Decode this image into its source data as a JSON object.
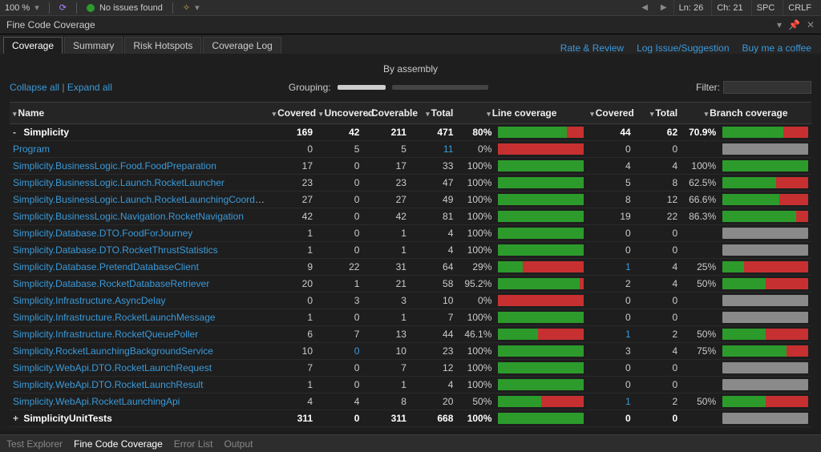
{
  "statusbar": {
    "zoom": "100 %",
    "issues": "No issues found",
    "ln": "Ln: 26",
    "ch": "Ch: 21",
    "spc": "SPC",
    "crlf": "CRLF"
  },
  "panel": {
    "title": "Fine Code Coverage"
  },
  "tabs": {
    "coverage": "Coverage",
    "summary": "Summary",
    "risk": "Risk Hotspots",
    "log": "Coverage Log"
  },
  "links": {
    "rate": "Rate & Review",
    "issue": "Log Issue/Suggestion",
    "coffee": "Buy me a coffee",
    "collapse": "Collapse all",
    "expand": "Expand all"
  },
  "labels": {
    "by_assembly": "By assembly",
    "grouping": "Grouping:",
    "filter": "Filter:"
  },
  "headers": {
    "name": "Name",
    "covered": "Covered",
    "uncovered": "Uncovered",
    "coverable": "Coverable",
    "total": "Total",
    "line_cov": "Line coverage",
    "covered2": "Covered",
    "total2": "Total",
    "branch_cov": "Branch coverage"
  },
  "rows": [
    {
      "type": "group",
      "expand": "-",
      "name": "Simplicity",
      "covered": "169",
      "uncovered": "42",
      "coverable": "211",
      "total": "471",
      "lpct": "80%",
      "lbar": 80,
      "bcov": "44",
      "btot": "62",
      "bpct": "70.9%",
      "bbar": 70.9
    },
    {
      "type": "item",
      "name": "Program",
      "covered": "0",
      "uncovered": "5",
      "coverable": "5",
      "total": "11",
      "total_low": true,
      "lpct": "0%",
      "lbar": 0,
      "bcov": "0",
      "btot": "0",
      "bpct": "",
      "bbar": null
    },
    {
      "type": "item",
      "name": "Simplicity.BusinessLogic.Food.FoodPreparation",
      "covered": "17",
      "uncovered": "0",
      "coverable": "17",
      "total": "33",
      "lpct": "100%",
      "lbar": 100,
      "bcov": "4",
      "btot": "4",
      "bpct": "100%",
      "bbar": 100
    },
    {
      "type": "item",
      "name": "Simplicity.BusinessLogic.Launch.RocketLauncher",
      "covered": "23",
      "uncovered": "0",
      "coverable": "23",
      "total": "47",
      "lpct": "100%",
      "lbar": 100,
      "bcov": "5",
      "btot": "8",
      "bpct": "62.5%",
      "bbar": 62.5
    },
    {
      "type": "item",
      "name": "Simplicity.BusinessLogic.Launch.RocketLaunchingCoordinator",
      "covered": "27",
      "uncovered": "0",
      "coverable": "27",
      "total": "49",
      "lpct": "100%",
      "lbar": 100,
      "bcov": "8",
      "btot": "12",
      "bpct": "66.6%",
      "bbar": 66.6
    },
    {
      "type": "item",
      "name": "Simplicity.BusinessLogic.Navigation.RocketNavigation",
      "covered": "42",
      "uncovered": "0",
      "coverable": "42",
      "total": "81",
      "lpct": "100%",
      "lbar": 100,
      "bcov": "19",
      "btot": "22",
      "bpct": "86.3%",
      "bbar": 86.3
    },
    {
      "type": "item",
      "name": "Simplicity.Database.DTO.FoodForJourney",
      "covered": "1",
      "uncovered": "0",
      "coverable": "1",
      "total": "4",
      "lpct": "100%",
      "lbar": 100,
      "bcov": "0",
      "btot": "0",
      "bpct": "",
      "bbar": null
    },
    {
      "type": "item",
      "name": "Simplicity.Database.DTO.RocketThrustStatistics",
      "covered": "1",
      "uncovered": "0",
      "coverable": "1",
      "total": "4",
      "lpct": "100%",
      "lbar": 100,
      "bcov": "0",
      "btot": "0",
      "bpct": "",
      "bbar": null
    },
    {
      "type": "item",
      "name": "Simplicity.Database.PretendDatabaseClient",
      "covered": "9",
      "uncovered": "22",
      "coverable": "31",
      "total": "64",
      "lpct": "29%",
      "lbar": 29,
      "bcov": "1",
      "bcov_low": true,
      "btot": "4",
      "bpct": "25%",
      "bbar": 25
    },
    {
      "type": "item",
      "name": "Simplicity.Database.RocketDatabaseRetriever",
      "covered": "20",
      "uncovered": "1",
      "coverable": "21",
      "total": "58",
      "lpct": "95.2%",
      "lbar": 95.2,
      "bcov": "2",
      "btot": "4",
      "bpct": "50%",
      "bbar": 50
    },
    {
      "type": "item",
      "name": "Simplicity.Infrastructure.AsyncDelay",
      "covered": "0",
      "uncovered": "3",
      "coverable": "3",
      "total": "10",
      "lpct": "0%",
      "lbar": 0,
      "bcov": "0",
      "btot": "0",
      "bpct": "",
      "bbar": null
    },
    {
      "type": "item",
      "name": "Simplicity.Infrastructure.RocketLaunchMessage",
      "covered": "1",
      "uncovered": "0",
      "coverable": "1",
      "total": "7",
      "lpct": "100%",
      "lbar": 100,
      "bcov": "0",
      "btot": "0",
      "bpct": "",
      "bbar": null
    },
    {
      "type": "item",
      "name": "Simplicity.Infrastructure.RocketQueuePoller",
      "covered": "6",
      "uncovered": "7",
      "coverable": "13",
      "total": "44",
      "lpct": "46.1%",
      "lbar": 46.1,
      "bcov": "1",
      "bcov_low": true,
      "btot": "2",
      "bpct": "50%",
      "bbar": 50
    },
    {
      "type": "item",
      "name": "Simplicity.RocketLaunchingBackgroundService",
      "covered": "10",
      "uncovered": "0",
      "uncov_low": true,
      "coverable": "10",
      "total": "23",
      "lpct": "100%",
      "lbar": 100,
      "bcov": "3",
      "btot": "4",
      "bpct": "75%",
      "bbar": 75
    },
    {
      "type": "item",
      "name": "Simplicity.WebApi.DTO.RocketLaunchRequest",
      "covered": "7",
      "uncovered": "0",
      "coverable": "7",
      "total": "12",
      "lpct": "100%",
      "lbar": 100,
      "bcov": "0",
      "btot": "0",
      "bpct": "",
      "bbar": null
    },
    {
      "type": "item",
      "name": "Simplicity.WebApi.DTO.RocketLaunchResult",
      "covered": "1",
      "uncovered": "0",
      "coverable": "1",
      "total": "4",
      "lpct": "100%",
      "lbar": 100,
      "bcov": "0",
      "btot": "0",
      "bpct": "",
      "bbar": null
    },
    {
      "type": "item",
      "name": "Simplicity.WebApi.RocketLaunchingApi",
      "covered": "4",
      "uncovered": "4",
      "coverable": "8",
      "total": "20",
      "lpct": "50%",
      "lbar": 50,
      "bcov": "1",
      "bcov_low": true,
      "btot": "2",
      "bpct": "50%",
      "bbar": 50
    },
    {
      "type": "group",
      "expand": "+",
      "name": "SimplicityUnitTests",
      "covered": "311",
      "uncovered": "0",
      "coverable": "311",
      "total": "668",
      "lpct": "100%",
      "lbar": 100,
      "bcov": "0",
      "btot": "0",
      "bpct": "",
      "bbar": null
    }
  ],
  "bottom_tabs": {
    "test_explorer": "Test Explorer",
    "fcc": "Fine Code Coverage",
    "error_list": "Error List",
    "output": "Output"
  }
}
